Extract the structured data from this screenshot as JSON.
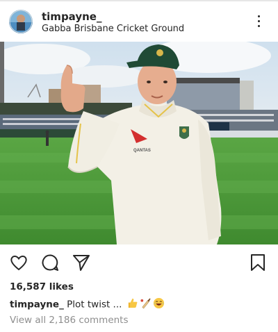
{
  "post": {
    "username": "timpayne_",
    "location": "Gabba Brisbane Cricket Ground",
    "likes": "16,587 likes",
    "caption_user": "timpayne_",
    "caption_text": " Plot twist ... ",
    "view_comments": "View all 2,186 comments"
  },
  "photo": {
    "jersey_sponsor": "QANTAS"
  },
  "icons": {
    "avatar": "profile-avatar",
    "more": "more-options-icon",
    "like": "heart-icon",
    "comment": "comment-icon",
    "share": "send-icon",
    "save": "bookmark-icon",
    "caption_emojis": [
      "thumbs-up-emoji",
      "cricket-bat-emoji",
      "laughing-emoji"
    ]
  },
  "colors": {
    "text": "#262626",
    "muted": "#8e8e8e",
    "grass": "#4f9a3a",
    "cap": "#1f4a35",
    "jersey": "#f3f0e6"
  }
}
